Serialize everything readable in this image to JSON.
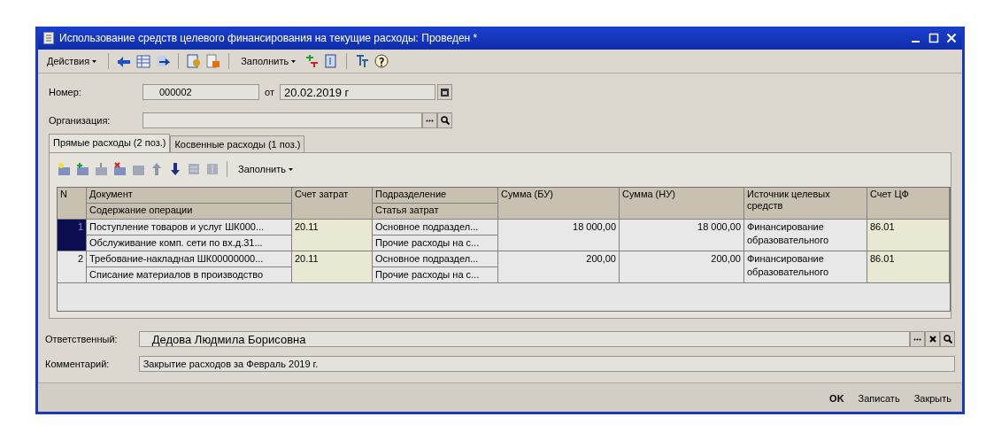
{
  "window": {
    "title": "Использование средств целевого финансирования на текущие расходы: Проведен *"
  },
  "toolbar": {
    "actions_menu": "Действия",
    "fill_menu": "Заполнить"
  },
  "header": {
    "number_label": "Номер:",
    "number": "000002",
    "date_label": "от",
    "date": "20.02.2019 г",
    "organization_label": "Организация:"
  },
  "tabs": [
    {
      "label": "Прямые расходы (2 поз.)",
      "selected": true
    },
    {
      "label": "Косвенные расходы (1 поз.)",
      "selected": false
    }
  ],
  "table_toolbar": {
    "fill_menu": "Заполнить"
  },
  "table": {
    "columns": [
      {
        "top": "N"
      },
      {
        "top": "Документ",
        "bottom": "Содержание операции"
      },
      {
        "top": "Счет затрат"
      },
      {
        "top": "Подразделение",
        "bottom": "Статья затрат"
      },
      {
        "top": "Сумма (БУ)"
      },
      {
        "top": "Сумма (НУ)"
      },
      {
        "top": "Источник целевых средств"
      },
      {
        "top": "Счет ЦФ"
      }
    ],
    "rows": [
      {
        "n": "1",
        "selected": true,
        "document": "Поступление товаров и услуг ШК000...",
        "content": "Обслуживание комп. сети по вх.д.31...",
        "account": "20.11",
        "division": "Основное подраздел...",
        "cost_item": "Прочие расходы на с...",
        "sum_bu": "18 000,00",
        "sum_nu": "18 000,00",
        "source": "Финансирование образовательного",
        "cf_account": "86.01"
      },
      {
        "n": "2",
        "selected": false,
        "document": "Требование-накладная ШК00000000...",
        "content": "Списание материалов в производство",
        "account": "20.11",
        "division": "Основное подраздел...",
        "cost_item": "Прочие расходы на с...",
        "sum_bu": "200,00",
        "sum_nu": "200,00",
        "source": "Финансирование образовательного",
        "cf_account": "86.01"
      }
    ]
  },
  "footer": {
    "responsible_label": "Ответственный:",
    "responsible": "Дедова Людмила Борисовна",
    "comment_label": "Комментарий:",
    "comment": "Закрытие расходов за Февраль 2019 г."
  },
  "buttons": [
    {
      "label": "OK",
      "kind": "default"
    },
    {
      "label": "Записать",
      "kind": "normal"
    },
    {
      "label": "Закрыть",
      "kind": "normal"
    }
  ]
}
